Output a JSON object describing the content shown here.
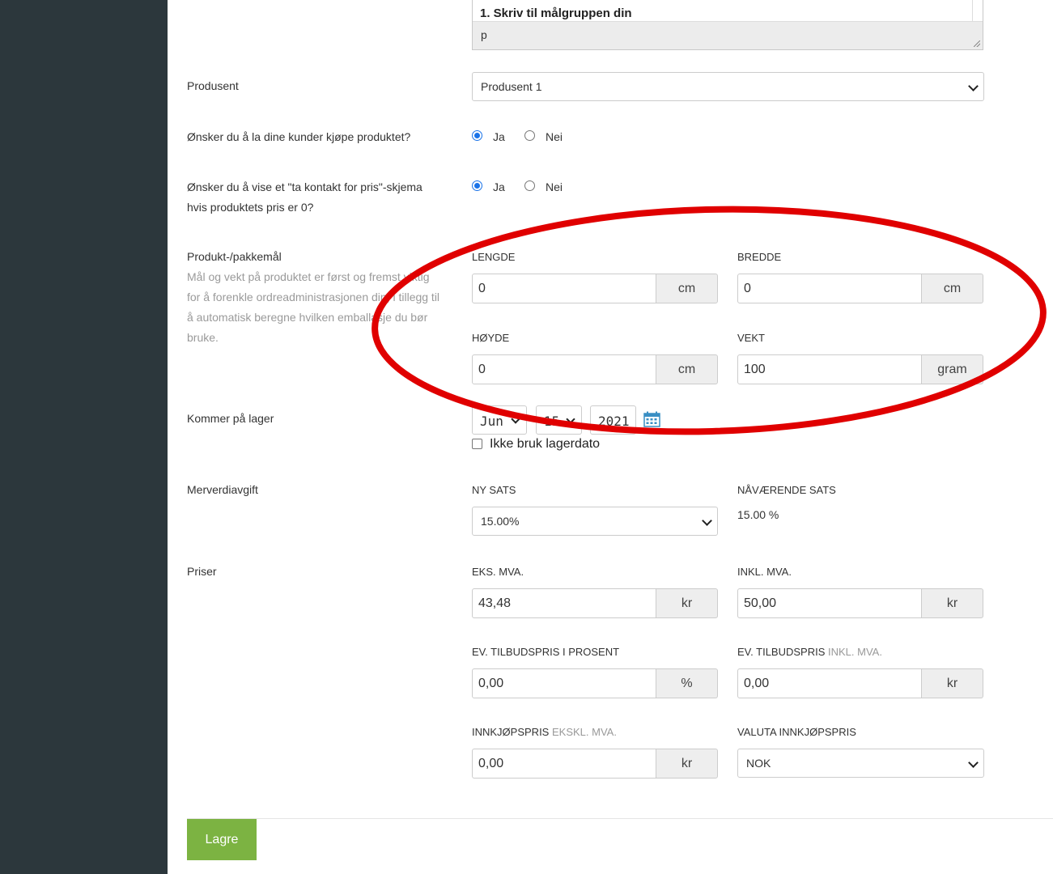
{
  "editor": {
    "toolbar_text": "1. Skriv til målgruppen din",
    "content": "p"
  },
  "producer": {
    "label": "Produsent",
    "selected": "Produsent 1"
  },
  "buy": {
    "label": "Ønsker du å la dine kunder kjøpe produktet?",
    "yes": "Ja",
    "no": "Nei",
    "selected": "Ja"
  },
  "contact": {
    "label_line1": "Ønsker du å vise et \"ta kontakt for pris\"-skjema",
    "label_line2": "hvis produktets pris er 0?",
    "yes": "Ja",
    "no": "Nei",
    "selected": "Ja"
  },
  "dimensions": {
    "label": "Produkt-/pakkemål",
    "help": [
      "Mål og vekt på produktet er først og fremst viktig",
      "for å forenkle ordreadministrasjonen din, i tillegg til",
      "å automatisk beregne hvilken emballasje du bør",
      "bruke."
    ],
    "length": {
      "caption": "LENGDE",
      "value": "0",
      "unit": "cm"
    },
    "width": {
      "caption": "BREDDE",
      "value": "0",
      "unit": "cm"
    },
    "height": {
      "caption": "HØYDE",
      "value": "0",
      "unit": "cm"
    },
    "weight": {
      "caption": "VEKT",
      "value": "100",
      "unit": "gram"
    }
  },
  "stock": {
    "label": "Kommer på lager",
    "month": "Jun",
    "day": "15",
    "year": "2021",
    "checkbox_label": "Ikke bruk lagerdato"
  },
  "vat": {
    "label": "Merverdiavgift",
    "new_caption": "NY SATS",
    "new_value": "15.00%",
    "current_caption": "NÅVÆRENDE SATS",
    "current_value": "15.00 %"
  },
  "prices": {
    "label": "Priser",
    "ex_caption": "EKS. MVA.",
    "ex_value": "43,48",
    "ex_unit": "kr",
    "inc_caption": "INKL. MVA.",
    "inc_value": "50,00",
    "inc_unit": "kr",
    "offer_pct_caption": "EV. TILBUDSPRIS I PROSENT",
    "offer_pct_value": "0,00",
    "offer_pct_unit": "%",
    "offer_caption": "EV. TILBUDSPRIS",
    "offer_caption_muted": "INKL. MVA.",
    "offer_value": "0,00",
    "offer_unit": "kr",
    "purchase_caption": "INNKJØPSPRIS",
    "purchase_caption_muted": "EKSKL. MVA.",
    "purchase_value": "0,00",
    "purchase_unit": "kr",
    "currency_caption": "VALUTA INNKJØPSPRIS",
    "currency_value": "NOK"
  },
  "save_label": "Lagre",
  "colors": {
    "sidebar": "#2c373c",
    "save_button": "#7cb342",
    "annotation": "#e00000"
  }
}
